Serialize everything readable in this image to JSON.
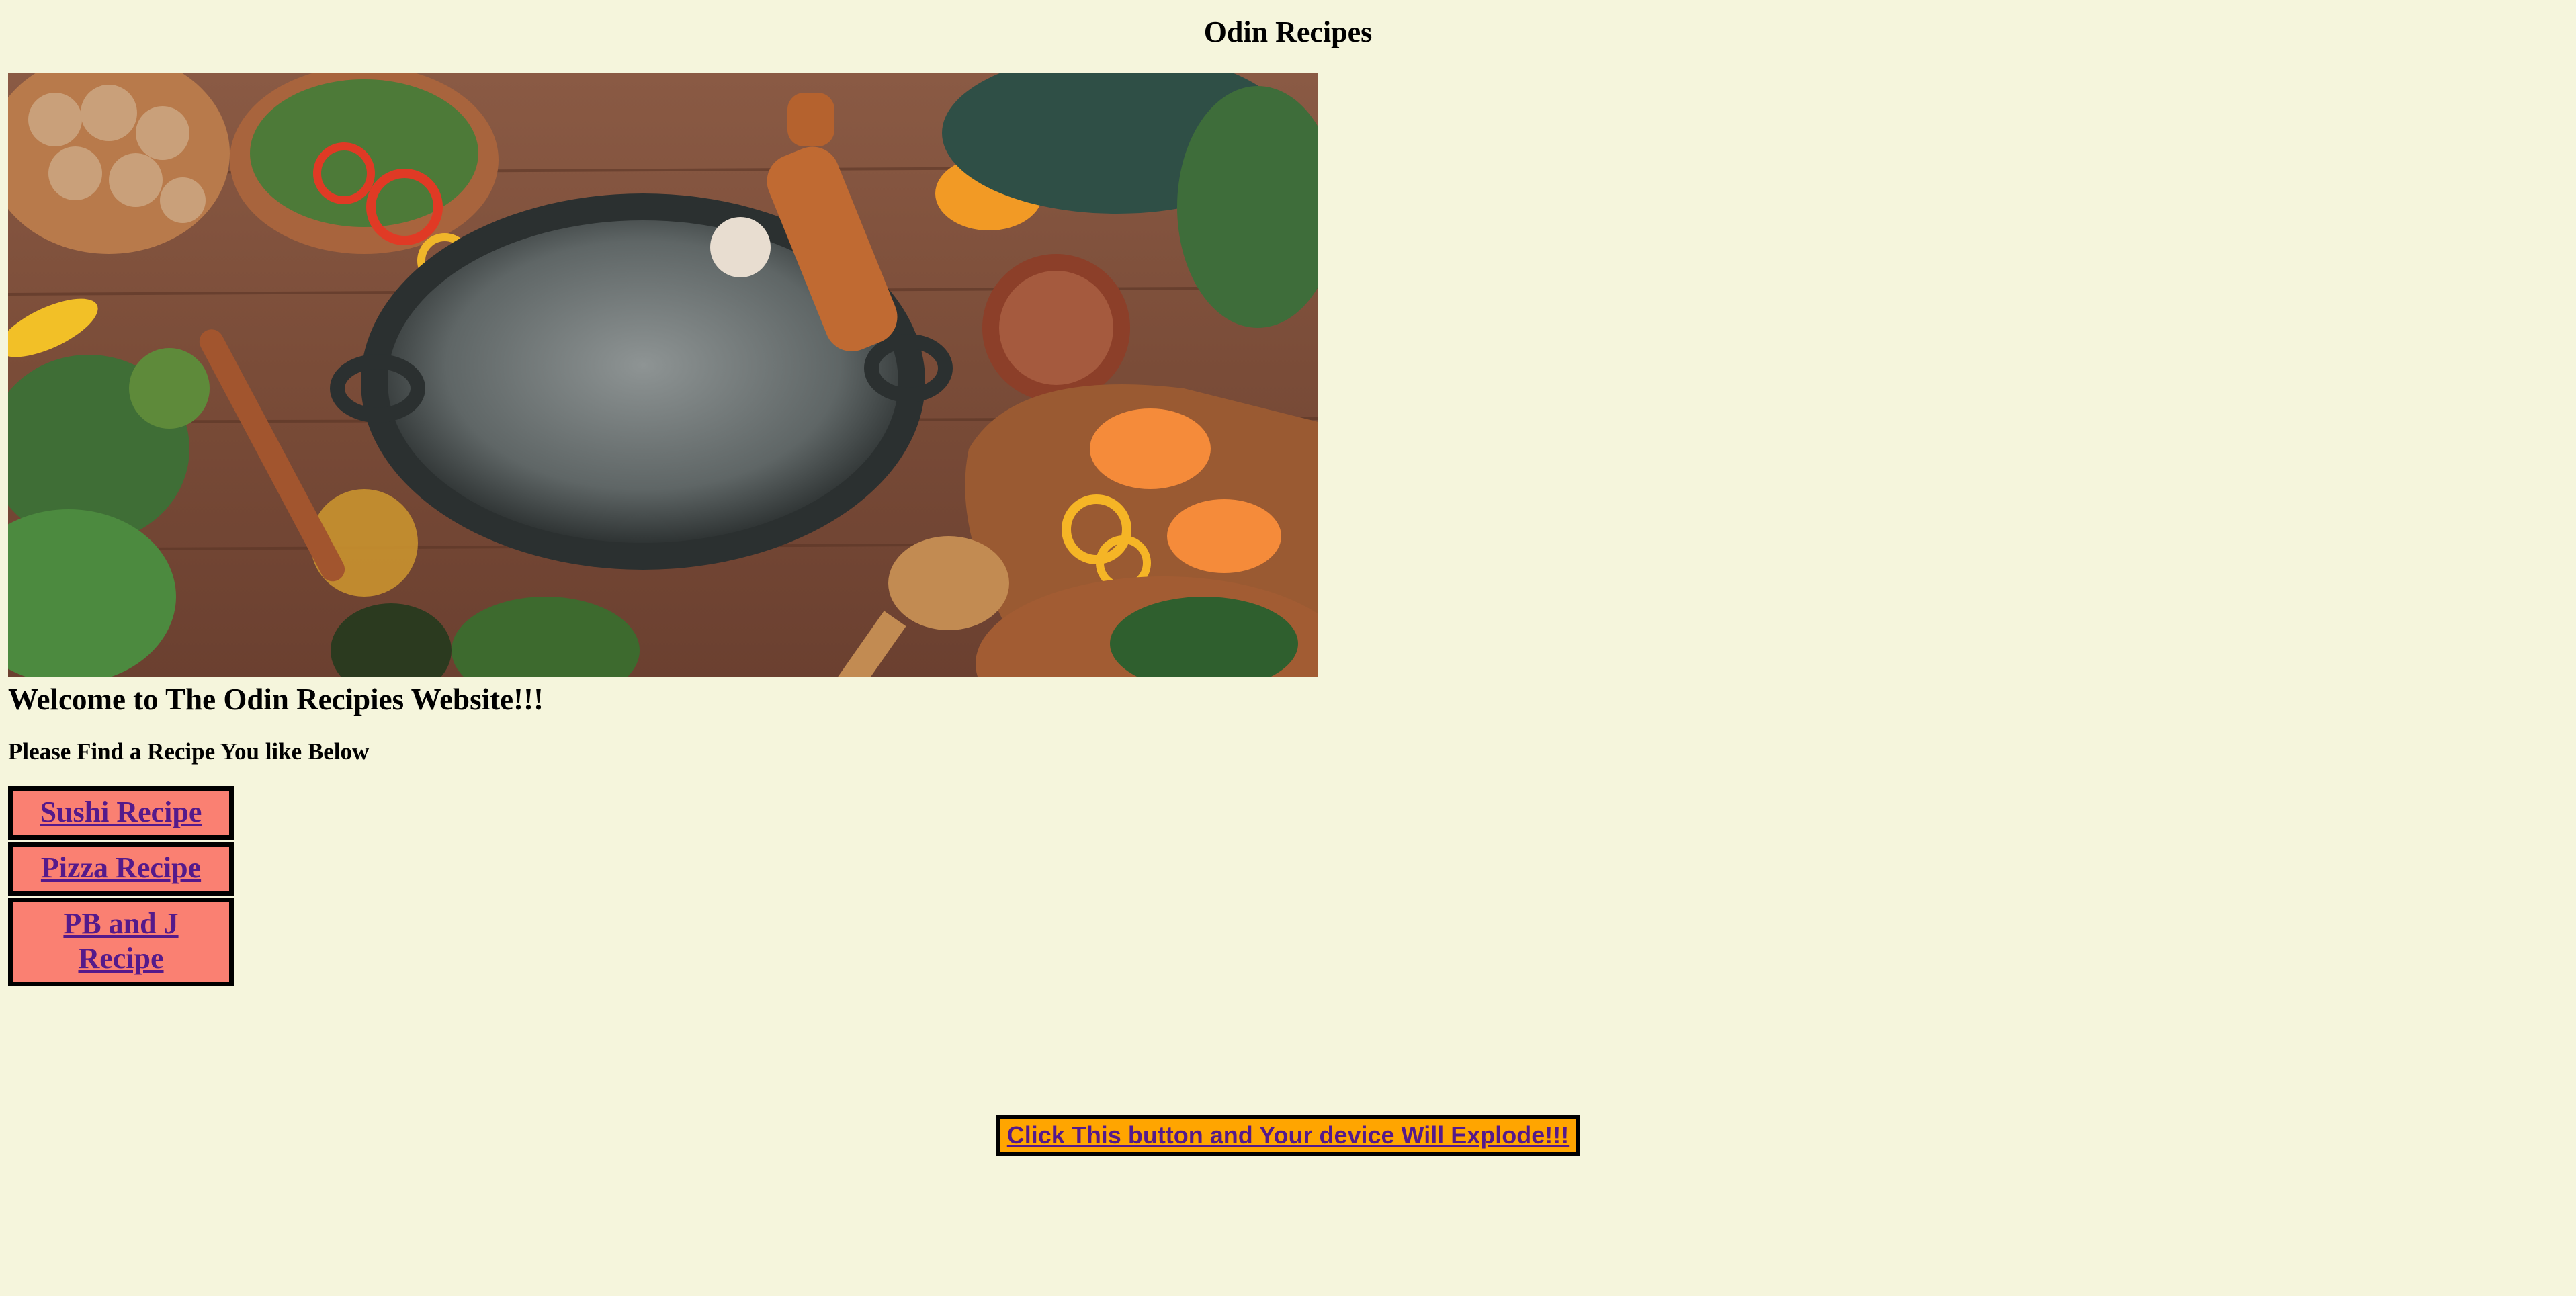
{
  "header": {
    "title": "Odin Recipes"
  },
  "hero": {
    "image_description_icon": "kitchen-flatlay-image"
  },
  "main": {
    "welcome": "Welcome to The Odin Recipies Website!!!",
    "subtitle": "Please Find a Recipe You like Below",
    "recipes": [
      {
        "label": "Sushi Recipe"
      },
      {
        "label": "Pizza Recipe"
      },
      {
        "label": "PB and J Recipe"
      }
    ]
  },
  "footer": {
    "explode_button": "Click This button and Your device Will Explode!!!"
  },
  "colors": {
    "background": "#f5f5dc",
    "recipe_box": "#fa8072",
    "link": "#551a8b",
    "explode_button": "#ffa500"
  }
}
